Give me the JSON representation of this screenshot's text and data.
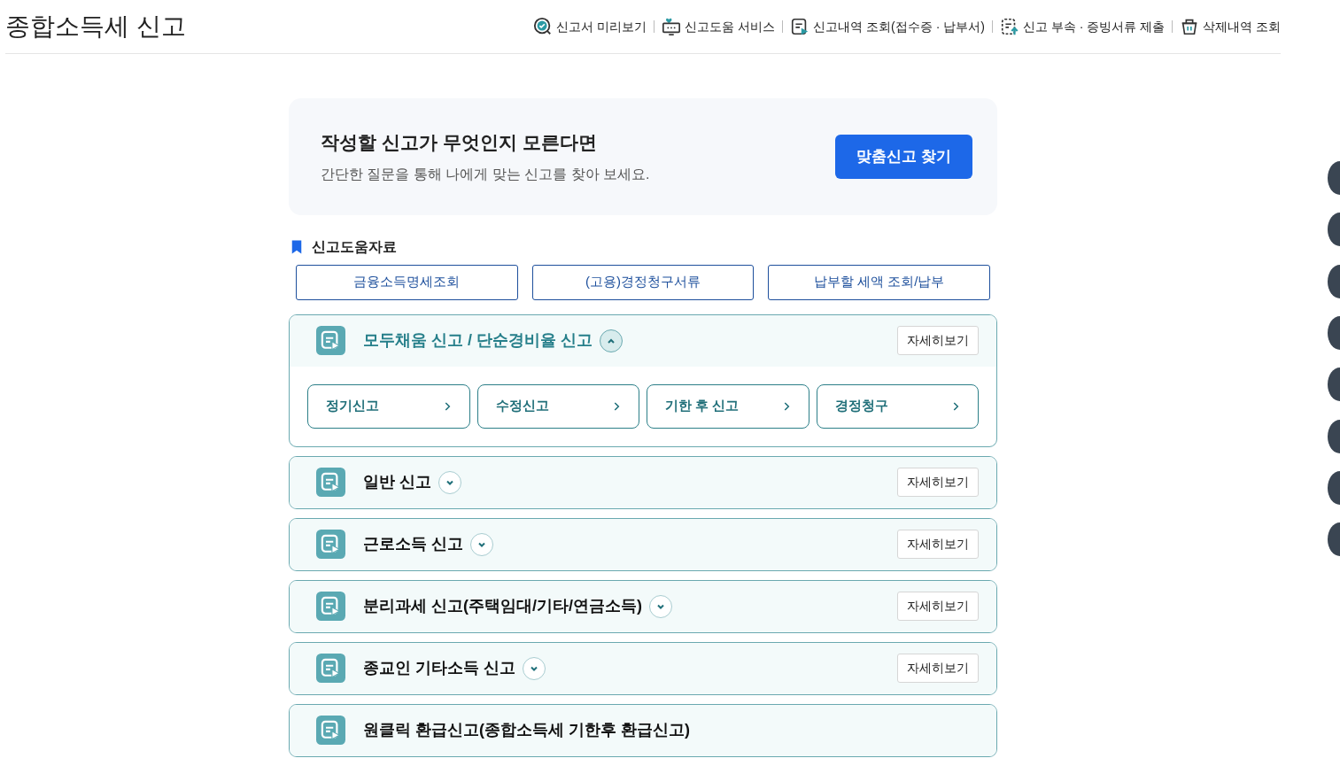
{
  "page_title": "종합소득세 신고",
  "top_links": [
    {
      "label": "신고서 미리보기",
      "kind": "preview"
    },
    {
      "label": "신고도움 서비스",
      "kind": "help"
    },
    {
      "label": "신고내역 조회(접수증 · 납부서)",
      "kind": "history"
    },
    {
      "label": "신고 부속 · 증빙서류 제출",
      "kind": "upload"
    },
    {
      "label": "삭제내역 조회",
      "kind": "trash"
    }
  ],
  "banner": {
    "title": "작성할 신고가 무엇인지 모른다면",
    "subtitle": "간단한 질문을 통해 나에게 맞는 신고를 찾아 보세요.",
    "button": "맞춤신고 찾기"
  },
  "help_materials": {
    "title": "신고도움자료",
    "links": [
      "금융소득명세조회",
      "(고용)경정청구서류",
      "납부할 세액 조회/납부"
    ]
  },
  "sections": [
    {
      "title": "모두채움 신고 / 단순경비율 신고",
      "expanded": true,
      "detail_button": "자세히보기",
      "options": [
        "정기신고",
        "수정신고",
        "기한 후 신고",
        "경정청구"
      ]
    },
    {
      "title": "일반 신고",
      "expanded": false,
      "detail_button": "자세히보기"
    },
    {
      "title": "근로소득 신고",
      "expanded": false,
      "detail_button": "자세히보기"
    },
    {
      "title": "분리과세 신고(주택임대/기타/연금소득)",
      "expanded": false,
      "detail_button": "자세히보기"
    },
    {
      "title": "종교인 기타소득 신고",
      "expanded": false,
      "detail_button": "자세히보기"
    },
    {
      "title": "원클릭 환급신고(종합소득세 기한후 환급신고)"
    }
  ]
}
